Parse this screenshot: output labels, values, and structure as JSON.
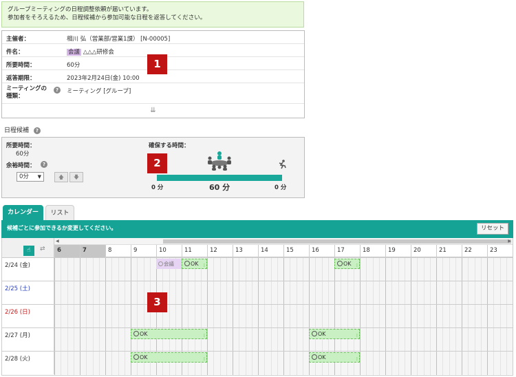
{
  "notice": {
    "line1": "グループミーティングの日程調整依頼が届いています。",
    "line2": "参加者をそろえるため、日程候補から参加可能な日程を返答してください。"
  },
  "info": {
    "organizer_label": "主催者：",
    "organizer_value": "相川 弘（営業部/営業1課） [N-00005]",
    "subject_label": "件名：",
    "subject_tag": "会議",
    "subject_value": " △△△研修会",
    "duration_label": "所要時間：",
    "duration_value": "60分",
    "deadline_label": "返答期限：",
    "deadline_value": "2023年2月24日(金) 10:00",
    "type_label_1": "ミーティングの",
    "type_label_2": "種類：",
    "type_value": "ミーティング [グループ]",
    "expand_icon": "⇊"
  },
  "badges": {
    "b1": "1",
    "b2": "2",
    "b3": "3"
  },
  "schedule": {
    "title": "日程候補",
    "duration_label": "所要時間：",
    "duration_value": "60分",
    "margin_label": "余裕時間：",
    "margin_select": "0分",
    "secure_label": "確保する時間：",
    "before": "0 分",
    "main": "60 分",
    "after": "0 分"
  },
  "tabs": {
    "calendar": "カレンダー",
    "list": "リスト"
  },
  "calendar": {
    "message": "候補ごとに参加できるか変更してください。",
    "reset": "リセット",
    "hours": [
      "6",
      "7",
      "8",
      "9",
      "10",
      "11",
      "12",
      "13",
      "14",
      "15",
      "16",
      "17",
      "18",
      "19",
      "20",
      "21",
      "22",
      "23"
    ],
    "days": [
      {
        "label": "2/24 (金)",
        "kind": "weekday"
      },
      {
        "label": "2/25 (土)",
        "kind": "sat"
      },
      {
        "label": "2/26 (日)",
        "kind": "sun"
      },
      {
        "label": "2/27 (月)",
        "kind": "weekday"
      },
      {
        "label": "2/28 (火)",
        "kind": "weekday"
      }
    ],
    "ok_label": "OK",
    "meeting_label": "会議",
    "colors": {
      "accent": "#14a394",
      "ok_fill": "#c9f0c2",
      "meeting_fill": "#e7d3f4",
      "badge": "#c01414"
    }
  }
}
